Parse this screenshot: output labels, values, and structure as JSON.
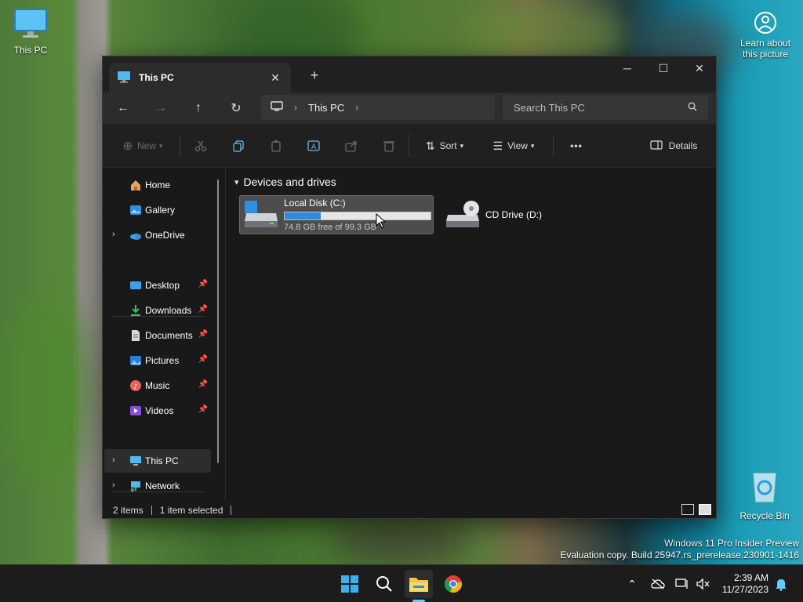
{
  "desktop": {
    "icons": [
      {
        "label": "This PC"
      },
      {
        "label": "Recycle Bin"
      }
    ],
    "learn_label": "Learn about this picture",
    "watermark": {
      "line1": "Windows 11 Pro Insider Preview",
      "line2": "Evaluation copy. Build 25947.rs_prerelease.230901-1416"
    }
  },
  "window": {
    "tab_title": "This PC",
    "tab_close": "✕",
    "new_tab": "+",
    "controls": {
      "minimize": "─",
      "maximize": "☐",
      "close": "✕"
    },
    "nav": {
      "back": "←",
      "forward": "→",
      "up": "↑",
      "refresh": "↻"
    },
    "address": {
      "location": "This PC",
      "sep1": "›",
      "sep2": "›"
    },
    "search": {
      "placeholder": "Search This PC"
    },
    "toolbar": {
      "new_label": "New",
      "sort_label": "Sort",
      "view_label": "View",
      "more_label": "•••",
      "details_label": "Details"
    },
    "sidebar": {
      "items": [
        {
          "label": "Home"
        },
        {
          "label": "Gallery"
        },
        {
          "label": "OneDrive"
        },
        {
          "label": "Desktop"
        },
        {
          "label": "Downloads"
        },
        {
          "label": "Documents"
        },
        {
          "label": "Pictures"
        },
        {
          "label": "Music"
        },
        {
          "label": "Videos"
        },
        {
          "label": "This PC"
        },
        {
          "label": "Network"
        }
      ]
    },
    "content": {
      "group_title": "Devices and drives",
      "drives": [
        {
          "name": "Local Disk (C:)",
          "free_text": "74.8 GB free of 99.3 GB",
          "used_fraction": 0.247
        },
        {
          "name": "CD Drive (D:)"
        }
      ]
    },
    "status": {
      "items": "2 items",
      "selected": "1 item selected"
    }
  },
  "taskbar": {
    "clock_time": "2:39 AM",
    "clock_date": "11/27/2023"
  },
  "colors": {
    "accent": "#2a8de0",
    "taskbar_active": "#60cdff"
  }
}
